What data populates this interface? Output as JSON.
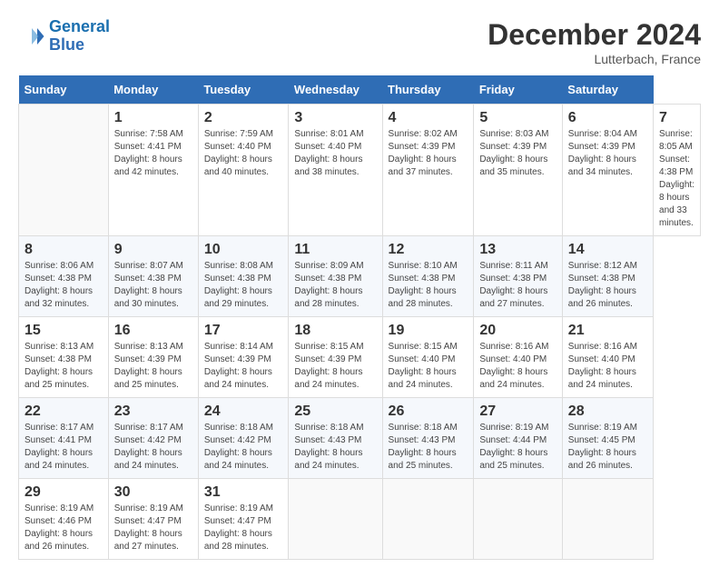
{
  "header": {
    "logo_line1": "General",
    "logo_line2": "Blue",
    "title": "December 2024",
    "subtitle": "Lutterbach, France"
  },
  "calendar": {
    "days_of_week": [
      "Sunday",
      "Monday",
      "Tuesday",
      "Wednesday",
      "Thursday",
      "Friday",
      "Saturday"
    ],
    "weeks": [
      [
        {
          "day": "",
          "info": ""
        },
        {
          "day": "1",
          "info": "Sunrise: 7:58 AM\nSunset: 4:41 PM\nDaylight: 8 hours\nand 42 minutes."
        },
        {
          "day": "2",
          "info": "Sunrise: 7:59 AM\nSunset: 4:40 PM\nDaylight: 8 hours\nand 40 minutes."
        },
        {
          "day": "3",
          "info": "Sunrise: 8:01 AM\nSunset: 4:40 PM\nDaylight: 8 hours\nand 38 minutes."
        },
        {
          "day": "4",
          "info": "Sunrise: 8:02 AM\nSunset: 4:39 PM\nDaylight: 8 hours\nand 37 minutes."
        },
        {
          "day": "5",
          "info": "Sunrise: 8:03 AM\nSunset: 4:39 PM\nDaylight: 8 hours\nand 35 minutes."
        },
        {
          "day": "6",
          "info": "Sunrise: 8:04 AM\nSunset: 4:39 PM\nDaylight: 8 hours\nand 34 minutes."
        },
        {
          "day": "7",
          "info": "Sunrise: 8:05 AM\nSunset: 4:38 PM\nDaylight: 8 hours\nand 33 minutes."
        }
      ],
      [
        {
          "day": "8",
          "info": "Sunrise: 8:06 AM\nSunset: 4:38 PM\nDaylight: 8 hours\nand 32 minutes."
        },
        {
          "day": "9",
          "info": "Sunrise: 8:07 AM\nSunset: 4:38 PM\nDaylight: 8 hours\nand 30 minutes."
        },
        {
          "day": "10",
          "info": "Sunrise: 8:08 AM\nSunset: 4:38 PM\nDaylight: 8 hours\nand 29 minutes."
        },
        {
          "day": "11",
          "info": "Sunrise: 8:09 AM\nSunset: 4:38 PM\nDaylight: 8 hours\nand 28 minutes."
        },
        {
          "day": "12",
          "info": "Sunrise: 8:10 AM\nSunset: 4:38 PM\nDaylight: 8 hours\nand 28 minutes."
        },
        {
          "day": "13",
          "info": "Sunrise: 8:11 AM\nSunset: 4:38 PM\nDaylight: 8 hours\nand 27 minutes."
        },
        {
          "day": "14",
          "info": "Sunrise: 8:12 AM\nSunset: 4:38 PM\nDaylight: 8 hours\nand 26 minutes."
        }
      ],
      [
        {
          "day": "15",
          "info": "Sunrise: 8:13 AM\nSunset: 4:38 PM\nDaylight: 8 hours\nand 25 minutes."
        },
        {
          "day": "16",
          "info": "Sunrise: 8:13 AM\nSunset: 4:39 PM\nDaylight: 8 hours\nand 25 minutes."
        },
        {
          "day": "17",
          "info": "Sunrise: 8:14 AM\nSunset: 4:39 PM\nDaylight: 8 hours\nand 24 minutes."
        },
        {
          "day": "18",
          "info": "Sunrise: 8:15 AM\nSunset: 4:39 PM\nDaylight: 8 hours\nand 24 minutes."
        },
        {
          "day": "19",
          "info": "Sunrise: 8:15 AM\nSunset: 4:40 PM\nDaylight: 8 hours\nand 24 minutes."
        },
        {
          "day": "20",
          "info": "Sunrise: 8:16 AM\nSunset: 4:40 PM\nDaylight: 8 hours\nand 24 minutes."
        },
        {
          "day": "21",
          "info": "Sunrise: 8:16 AM\nSunset: 4:40 PM\nDaylight: 8 hours\nand 24 minutes."
        }
      ],
      [
        {
          "day": "22",
          "info": "Sunrise: 8:17 AM\nSunset: 4:41 PM\nDaylight: 8 hours\nand 24 minutes."
        },
        {
          "day": "23",
          "info": "Sunrise: 8:17 AM\nSunset: 4:42 PM\nDaylight: 8 hours\nand 24 minutes."
        },
        {
          "day": "24",
          "info": "Sunrise: 8:18 AM\nSunset: 4:42 PM\nDaylight: 8 hours\nand 24 minutes."
        },
        {
          "day": "25",
          "info": "Sunrise: 8:18 AM\nSunset: 4:43 PM\nDaylight: 8 hours\nand 24 minutes."
        },
        {
          "day": "26",
          "info": "Sunrise: 8:18 AM\nSunset: 4:43 PM\nDaylight: 8 hours\nand 25 minutes."
        },
        {
          "day": "27",
          "info": "Sunrise: 8:19 AM\nSunset: 4:44 PM\nDaylight: 8 hours\nand 25 minutes."
        },
        {
          "day": "28",
          "info": "Sunrise: 8:19 AM\nSunset: 4:45 PM\nDaylight: 8 hours\nand 26 minutes."
        }
      ],
      [
        {
          "day": "29",
          "info": "Sunrise: 8:19 AM\nSunset: 4:46 PM\nDaylight: 8 hours\nand 26 minutes."
        },
        {
          "day": "30",
          "info": "Sunrise: 8:19 AM\nSunset: 4:47 PM\nDaylight: 8 hours\nand 27 minutes."
        },
        {
          "day": "31",
          "info": "Sunrise: 8:19 AM\nSunset: 4:47 PM\nDaylight: 8 hours\nand 28 minutes."
        },
        {
          "day": "",
          "info": ""
        },
        {
          "day": "",
          "info": ""
        },
        {
          "day": "",
          "info": ""
        },
        {
          "day": "",
          "info": ""
        }
      ]
    ]
  }
}
